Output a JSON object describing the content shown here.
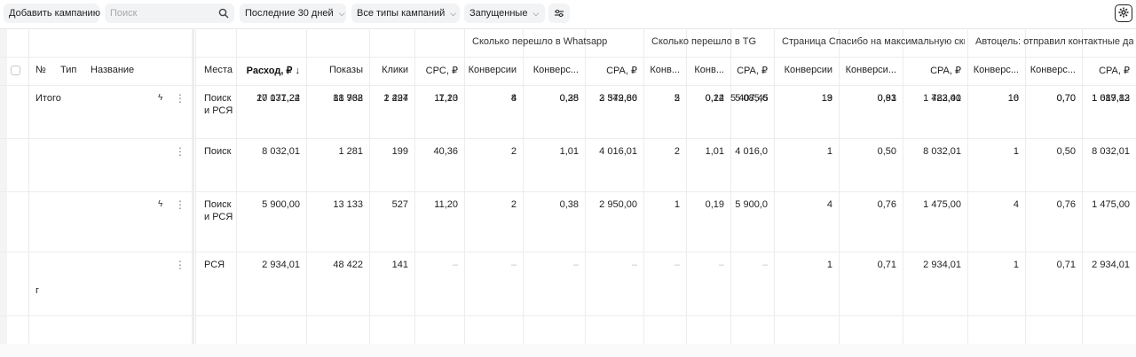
{
  "toolbar": {
    "add_campaign": "Добавить кампанию",
    "search_placeholder": "Поиск",
    "period": "Последние 30 дней",
    "campaign_types": "Все типы кампаний",
    "status": "Запущенные"
  },
  "groups": {
    "whatsapp": "Сколько перешло в Whatsapp",
    "tg": "Сколько перешло в TG",
    "thanks": "Страница Спасибо на максимальную ски...",
    "auto": "Автоцель: отправил контактные дан..."
  },
  "columns": {
    "num": "№",
    "type": "Тип",
    "name": "Название",
    "places": "Места",
    "spend": "Расход, ₽ ↓",
    "impressions": "Показы",
    "clicks": "Клики",
    "cpc": "CPC, ₽",
    "wa_conv": "Конверсии",
    "wa_rate": "Конверс...",
    "wa_cpa": "CPA, ₽",
    "tg_conv": "Конв...",
    "tg_rate": "Конв...",
    "tg_cpa": "CPA, ₽",
    "th_conv": "Конверсии",
    "th_rate": "Конверси...",
    "th_cpa": "CPA, ₽",
    "au_conv": "Конверс...",
    "au_rate": "Конверс...",
    "au_cpa": "CPA, ₽"
  },
  "total": {
    "label": "Итого",
    "spend": "27 037,24",
    "impressions": "81 768",
    "clicks": "2 294",
    "cpc": "11,20",
    "wa_conv": "8",
    "wa_rate": "0,35",
    "wa_cpa": "3 379,66",
    "tg_conv": "5",
    "tg_rate": "0,22",
    "tg_cpa": "5 407,45",
    "th_conv": "19",
    "th_rate": "0,83",
    "th_cpa": "1 423,01",
    "au_conv": "16",
    "au_rate": "0,70",
    "au_cpa": "1 689,83"
  },
  "rows": [
    {
      "places": [
        "Поиск",
        "и РСЯ"
      ],
      "name_tail": "",
      "spend": "10 171,22",
      "impressions": "18 932",
      "clicks": "1 427",
      "cpc": "7,13",
      "wa_conv": "4",
      "wa_rate": "0,28",
      "wa_cpa": "2 542,80",
      "tg_conv": "2",
      "tg_rate": "0,14",
      "tg_cpa": "5 085,6",
      "th_conv": "13",
      "th_rate": "0,91",
      "th_cpa": "782,40",
      "au_conv": "10",
      "au_rate": "0,70",
      "au_cpa": "1 017,12"
    },
    {
      "places": [
        "Поиск",
        ""
      ],
      "name_tail": "",
      "spend": "8 032,01",
      "impressions": "1 281",
      "clicks": "199",
      "cpc": "40,36",
      "wa_conv": "2",
      "wa_rate": "1,01",
      "wa_cpa": "4 016,01",
      "tg_conv": "2",
      "tg_rate": "1,01",
      "tg_cpa": "4 016,0",
      "th_conv": "1",
      "th_rate": "0,50",
      "th_cpa": "8 032,01",
      "au_conv": "1",
      "au_rate": "0,50",
      "au_cpa": "8 032,01"
    },
    {
      "places": [
        "Поиск",
        "и РСЯ"
      ],
      "name_tail": "",
      "spend": "5 900,00",
      "impressions": "13 133",
      "clicks": "527",
      "cpc": "11,20",
      "wa_conv": "2",
      "wa_rate": "0,38",
      "wa_cpa": "2 950,00",
      "tg_conv": "1",
      "tg_rate": "0,19",
      "tg_cpa": "5 900,0",
      "th_conv": "4",
      "th_rate": "0,76",
      "th_cpa": "1 475,00",
      "au_conv": "4",
      "au_rate": "0,76",
      "au_cpa": "1 475,00"
    },
    {
      "places": [
        "РСЯ",
        ""
      ],
      "name_tail": "г",
      "spend": "2 934,01",
      "impressions": "48 422",
      "clicks": "141",
      "cpc": "–",
      "wa_conv": "–",
      "wa_rate": "–",
      "wa_cpa": "–",
      "tg_conv": "–",
      "tg_rate": "–",
      "tg_cpa": "–",
      "th_conv": "1",
      "th_rate": "0,71",
      "th_cpa": "2 934,01",
      "au_conv": "1",
      "au_rate": "0,71",
      "au_cpa": "2 934,01"
    }
  ],
  "icons": {
    "search": "search-icon",
    "filter": "sliders-icon",
    "settings": "gear-icon",
    "bolt": "lightning-icon",
    "more": "kebab-icon"
  }
}
